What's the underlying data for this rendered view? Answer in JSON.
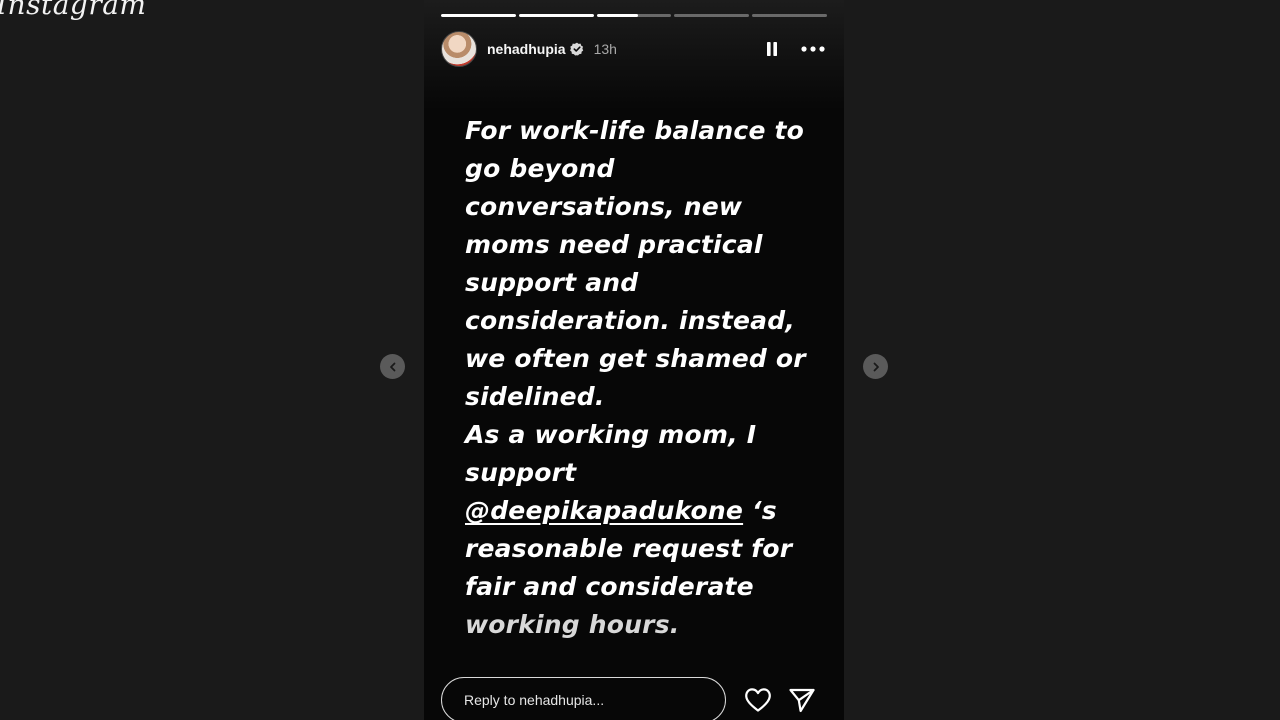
{
  "app": {
    "logo_text": "Instagram"
  },
  "story": {
    "user": {
      "username": "nehadhupia",
      "verified": true,
      "posted_ago": "13h"
    },
    "progress": [
      {
        "filled": 1.0
      },
      {
        "filled": 1.0
      },
      {
        "filled": 0.55
      },
      {
        "filled": 0.0
      },
      {
        "filled": 0.0
      }
    ],
    "text": {
      "para1": "For work-life balance to go beyond conversations, new moms need practical support and consideration. instead, we often get shamed or sidelined.",
      "para2_before": "As a working mom, I support ",
      "mention": "@deepikapadukone",
      "para2_after": " ‘s reasonable request for fair and considerate",
      "para2_last": "working hours."
    },
    "reply": {
      "placeholder": "Reply to nehadhupia..."
    }
  },
  "icons": {
    "verified": "verified-badge-icon",
    "pause": "pause-icon",
    "more": "more-options-icon",
    "prev": "chevron-left-icon",
    "next": "chevron-right-icon",
    "like": "heart-icon",
    "share": "send-icon"
  },
  "colors": {
    "background": "#1a1a1a",
    "story_bg": "#070707",
    "text": "#ffffff",
    "muted": "#a8a8a8"
  }
}
